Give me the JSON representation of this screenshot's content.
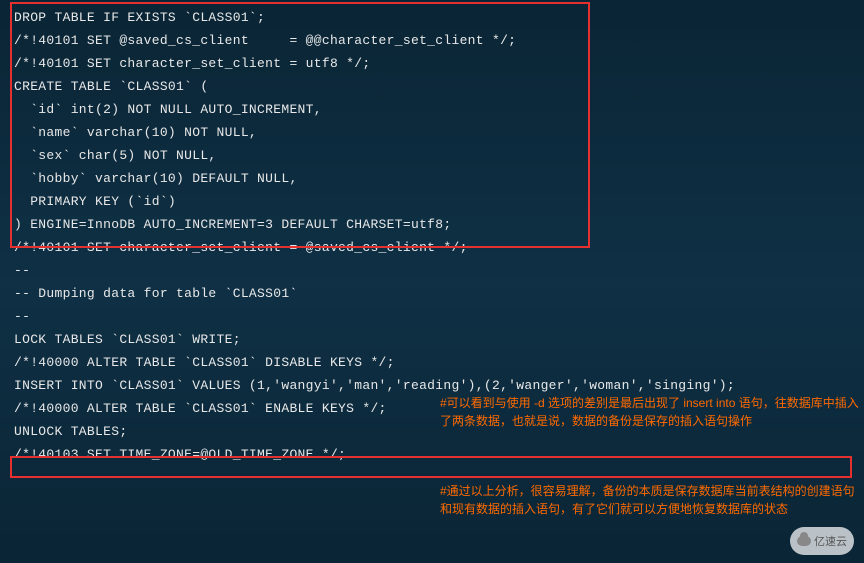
{
  "code_lines": [
    "DROP TABLE IF EXISTS `CLASS01`;",
    "/*!40101 SET @saved_cs_client     = @@character_set_client */;",
    "/*!40101 SET character_set_client = utf8 */;",
    "CREATE TABLE `CLASS01` (",
    "  `id` int(2) NOT NULL AUTO_INCREMENT,",
    "  `name` varchar(10) NOT NULL,",
    "  `sex` char(5) NOT NULL,",
    "  `hobby` varchar(10) DEFAULT NULL,",
    "  PRIMARY KEY (`id`)",
    ") ENGINE=InnoDB AUTO_INCREMENT=3 DEFAULT CHARSET=utf8;",
    "/*!40101 SET character_set_client = @saved_cs_client */;",
    "",
    "--",
    "-- Dumping data for table `CLASS01`",
    "--",
    "",
    "LOCK TABLES `CLASS01` WRITE;",
    "/*!40000 ALTER TABLE `CLASS01` DISABLE KEYS */;",
    "INSERT INTO `CLASS01` VALUES (1,'wangyi','man','reading'),(2,'wanger','woman','singing');",
    "/*!40000 ALTER TABLE `CLASS01` ENABLE KEYS */;",
    "UNLOCK TABLES;",
    "/*!40103 SET TIME_ZONE=@OLD_TIME_ZONE */;"
  ],
  "annotations": {
    "upper": "#可以看到与使用 -d 选项的差别是最后出现了 insert into 语句，往数据库中插入了两条数据，也就是说，数据的备份是保存的插入语句操作",
    "lower": "#通过以上分析，很容易理解，备份的本质是保存数据库当前表结构的创建语句和现有数据的插入语句，有了它们就可以方便地恢复数据库的状态"
  },
  "watermark": "亿速云",
  "highlight_boxes": {
    "upper": {
      "line_start": 0,
      "line_end": 9
    },
    "lower": {
      "line": 18
    }
  }
}
